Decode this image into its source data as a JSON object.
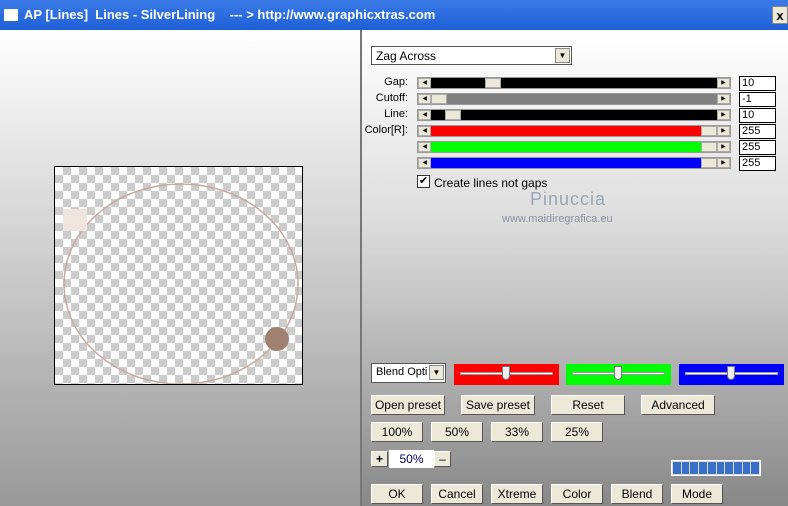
{
  "window": {
    "title": "AP [Lines]  Lines - SilverLining    --- > http://www.graphicxtras.com",
    "close": "x"
  },
  "mode_dropdown": {
    "value": "Zag Across"
  },
  "sliders": [
    {
      "label": "Gap:",
      "value": "10",
      "position_fraction": 0.2,
      "fill": "#000000",
      "color": "#000000"
    },
    {
      "label": "Cutoff:",
      "value": "-1",
      "position_fraction": 0.0,
      "fill": "#808080"
    },
    {
      "label": "Line:",
      "value": "10",
      "position_fraction": 0.05,
      "fill": "#000000"
    },
    {
      "label": "Color[R]:",
      "value": "255",
      "position_fraction": 1.0,
      "fill": "#ff0000"
    },
    {
      "label": "",
      "value": "255",
      "position_fraction": 1.0,
      "fill": "#00ff00"
    },
    {
      "label": "",
      "value": "255",
      "position_fraction": 1.0,
      "fill": "#0000ff"
    }
  ],
  "checkbox": {
    "label": "Create lines not gaps",
    "checked": true
  },
  "watermark": {
    "name": "Pinuccia",
    "url": "www.maidiregrafica.eu"
  },
  "blend": {
    "dropdown": "Blend Opti",
    "sliders": [
      {
        "color": "#ff0000",
        "fraction": 0.5
      },
      {
        "color": "#00ff00",
        "fraction": 0.5
      },
      {
        "color": "#0000ff",
        "fraction": 0.5
      }
    ]
  },
  "buttons": {
    "open_preset": "Open preset",
    "save_preset": "Save preset",
    "reset": "Reset",
    "advanced": "Advanced",
    "z100": "100%",
    "z50": "50%",
    "z33": "33%",
    "z25": "25%",
    "plus": "+",
    "minus": "–",
    "ok": "OK",
    "cancel": "Cancel",
    "xtreme": "Xtreme",
    "color": "Color",
    "blend": "Blend",
    "mode": "Mode"
  },
  "zoom": {
    "value": "50%"
  },
  "progress": {
    "segments": 10,
    "filled": 10
  }
}
